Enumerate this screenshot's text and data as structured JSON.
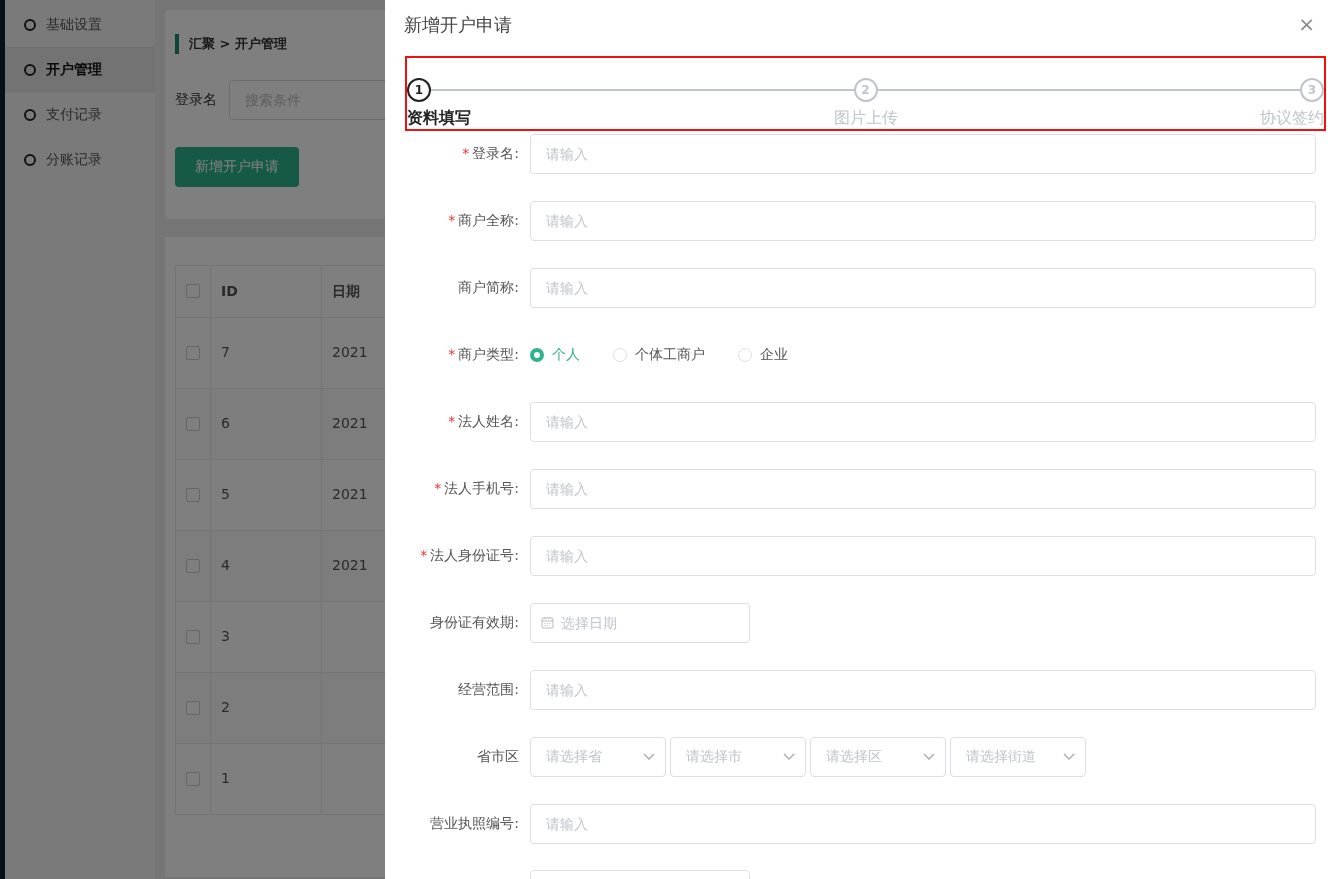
{
  "sidebar": {
    "items": [
      {
        "label": "基础设置",
        "selected": false
      },
      {
        "label": "开户管理",
        "selected": true
      },
      {
        "label": "支付记录",
        "selected": false
      },
      {
        "label": "分账记录",
        "selected": false
      }
    ]
  },
  "breadcrumb": "汇聚 > 开户管理",
  "search": {
    "label": "登录名",
    "placeholder": "搜索条件"
  },
  "add_button": "新增开户申请",
  "table": {
    "all_checked": false,
    "columns": [
      "ID",
      "日期"
    ],
    "rows": [
      {
        "id": "7",
        "date": "2021",
        "checked": false
      },
      {
        "id": "6",
        "date": "2021",
        "checked": false
      },
      {
        "id": "5",
        "date": "2021",
        "checked": false
      },
      {
        "id": "4",
        "date": "2021",
        "checked": false
      },
      {
        "id": "3",
        "checked": false
      },
      {
        "id": "2",
        "checked": false
      },
      {
        "id": "1",
        "checked": false
      }
    ]
  },
  "drawer": {
    "title": "新增开户申请",
    "close": "×",
    "steps_highlighted": true,
    "steps": [
      {
        "number": "1",
        "label": "资料填写",
        "selected": true
      },
      {
        "number": "2",
        "label": "图片上传",
        "selected": false
      },
      {
        "number": "3",
        "label": "协议签约",
        "selected": false
      }
    ],
    "fields": [
      {
        "kind": "text",
        "label": "登录名:",
        "required_mark": "*",
        "placeholder": "请输入"
      },
      {
        "kind": "text",
        "label": "商户全称:",
        "required_mark": "*",
        "placeholder": "请输入"
      },
      {
        "kind": "text",
        "label": "商户简称:",
        "placeholder": "请输入"
      },
      {
        "kind": "radio",
        "label": "商户类型:",
        "required_mark": "*",
        "options": [
          {
            "label": "个人",
            "selected": true
          },
          {
            "label": "个体工商户",
            "selected": false
          },
          {
            "label": "企业",
            "selected": false
          }
        ]
      },
      {
        "kind": "text",
        "label": "法人姓名:",
        "required_mark": "*",
        "placeholder": "请输入"
      },
      {
        "kind": "text",
        "label": "法人手机号:",
        "required_mark": "*",
        "placeholder": "请输入"
      },
      {
        "kind": "text",
        "label": "法人身份证号:",
        "required_mark": "*",
        "placeholder": "请输入"
      },
      {
        "kind": "date",
        "label": "身份证有效期:",
        "placeholder": "选择日期"
      },
      {
        "kind": "text",
        "label": "经营范围:",
        "placeholder": "请输入"
      },
      {
        "kind": "selects",
        "label": "省市区",
        "placeholders": [
          "请选择省",
          "请选择市",
          "请选择区",
          "请选择街道"
        ]
      },
      {
        "kind": "text",
        "label": "营业执照编号:",
        "placeholder": "请输入"
      },
      {
        "kind": "cut"
      }
    ]
  }
}
